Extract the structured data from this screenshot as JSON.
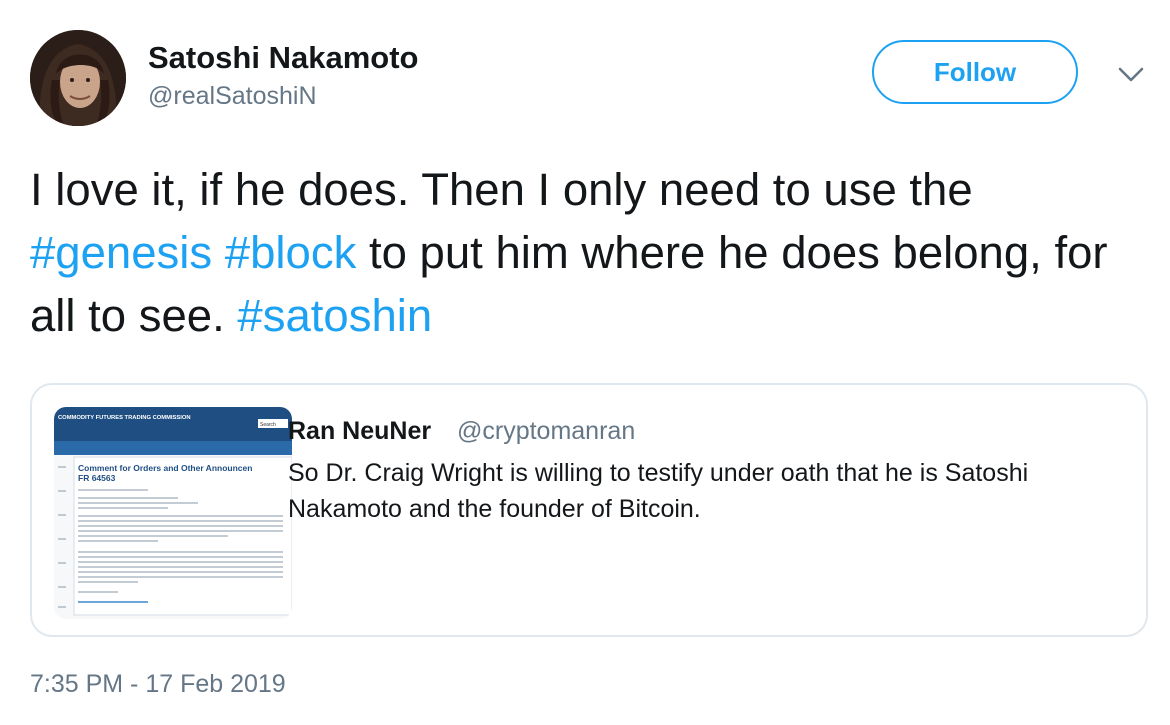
{
  "tweet": {
    "author_name": "Satoshi Nakamoto",
    "author_handle": "@realSatoshiN",
    "follow_label": "Follow",
    "text_part1": "I love it, if he does. Then I only need to use the ",
    "hashtag1": "#genesis",
    "text_space": " ",
    "hashtag2": "#block",
    "text_part2": " to put him where he does belong, for all to see. ",
    "hashtag3": "#satoshin",
    "timestamp": "7:35 PM - 17 Feb 2019"
  },
  "quoted_tweet": {
    "author_name": "Ran NeuNer",
    "author_handle": "@cryptomanran",
    "text": "So Dr. Craig Wright is willing to testify under oath that he is Satoshi Nakamoto and the founder of Bitcoin.",
    "thumbnail": {
      "org_name": "COMMODITY FUTURES TRADING COMMISSION",
      "search_label": "Search",
      "heading": "Comment for Orders and Other Announcen",
      "ref": "FR 64563"
    }
  },
  "colors": {
    "accent": "#1da1f2",
    "secondary_text": "#657786",
    "border": "#e1e8ed"
  },
  "icons": {
    "caret": "chevron-down-icon"
  }
}
